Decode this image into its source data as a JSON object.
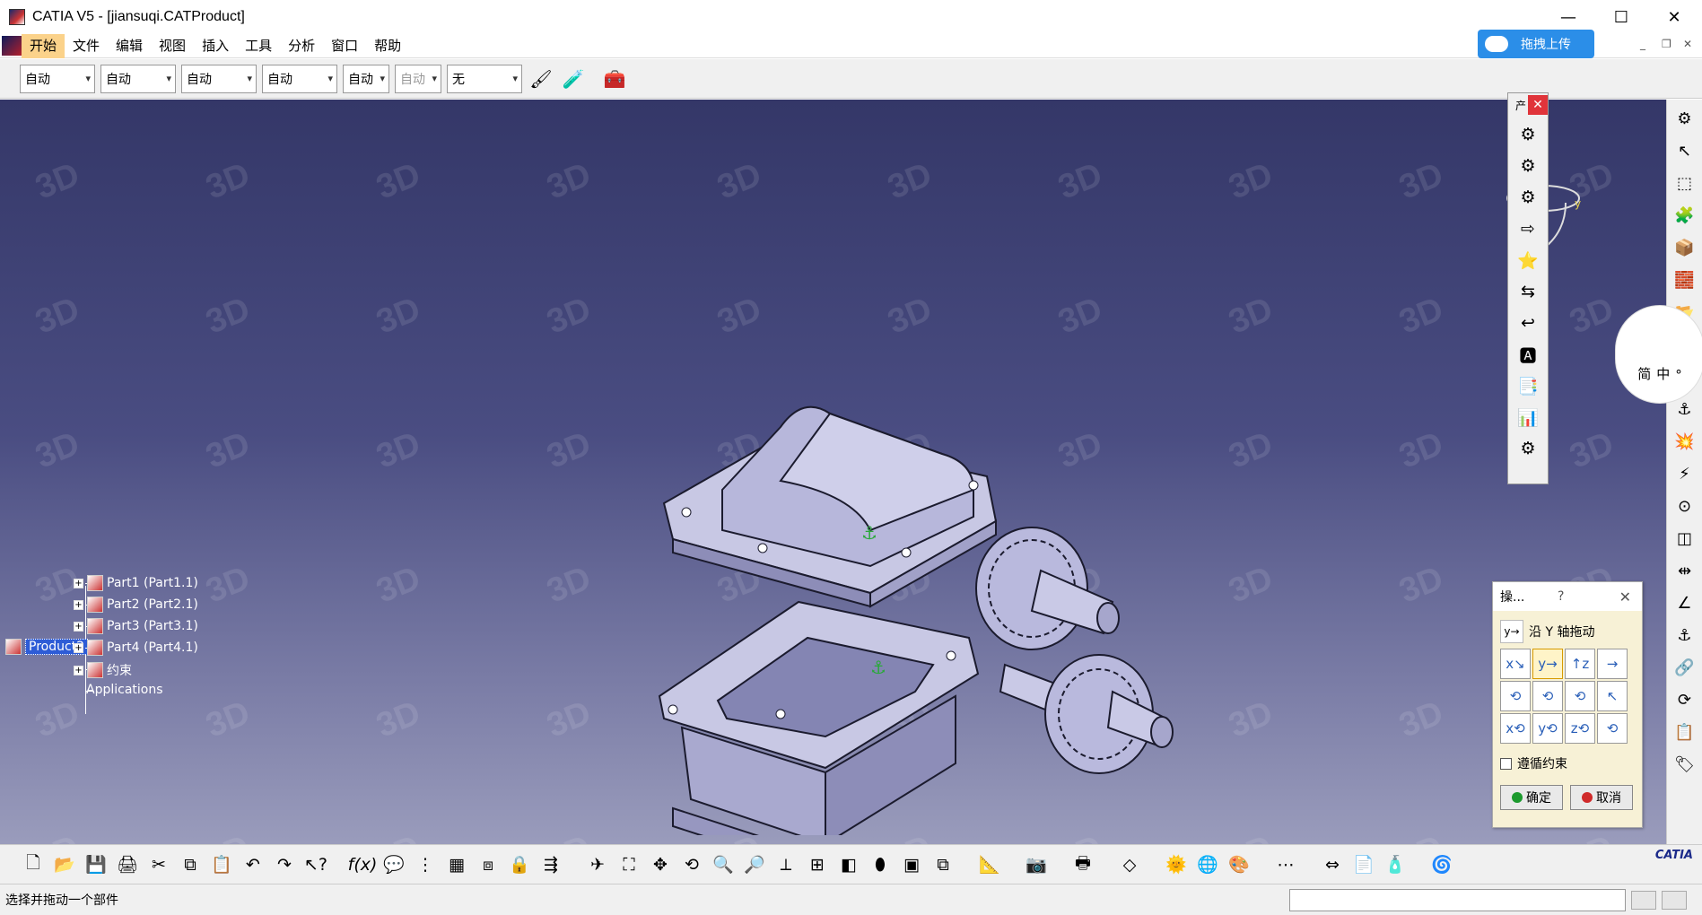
{
  "window": {
    "title": "CATIA V5 - [jiansuqi.CATProduct]",
    "controls": {
      "minimize": "—",
      "maximize": "☐",
      "close": "✕"
    }
  },
  "menubar": {
    "items": [
      "开始",
      "文件",
      "编辑",
      "视图",
      "插入",
      "工具",
      "分析",
      "窗口",
      "帮助"
    ],
    "active_index": 0,
    "upload_button_label": "拖拽上传"
  },
  "top_toolbar": {
    "combos": [
      "自动",
      "自动",
      "自动",
      "自动",
      "自动",
      "自动",
      "无"
    ]
  },
  "spec_tree": {
    "root": "Product2",
    "children": [
      "Part1 (Part1.1)",
      "Part2 (Part2.1)",
      "Part3 (Part3.1)",
      "Part4 (Part4.1)",
      "约束",
      "Applications"
    ]
  },
  "floating_toolbar": {
    "title": "产",
    "close": "✕",
    "icons": [
      "gear-assembly-icon",
      "existing-component-icon",
      "component-positioning-icon",
      "replace-component-icon",
      "reorder-tree-icon",
      "generate-numbering-icon",
      "selective-load-icon",
      "manage-representations-icon",
      "multi-instantiation-icon",
      "fast-multi-instantiation-icon",
      "define-multi-instantiation-icon"
    ]
  },
  "ime": {
    "mode": "简",
    "lang": "中",
    "extra": "°"
  },
  "manipulation_dialog": {
    "title": "操...",
    "help": "?",
    "close": "✕",
    "mode_label": "沿 Y 轴拖动",
    "grid": [
      "x↘",
      "y→",
      "↑z",
      "→",
      "⟲",
      "⟲",
      "⟲",
      "↖",
      "x⟲",
      "y⟲",
      "z⟲",
      "⟲"
    ],
    "selected_index": 1,
    "respect_constraints_label": "遵循约束",
    "ok_label": "确定",
    "cancel_label": "取消"
  },
  "statusbar": {
    "message": "选择并拖动一个部件"
  },
  "brand": "CATIA"
}
